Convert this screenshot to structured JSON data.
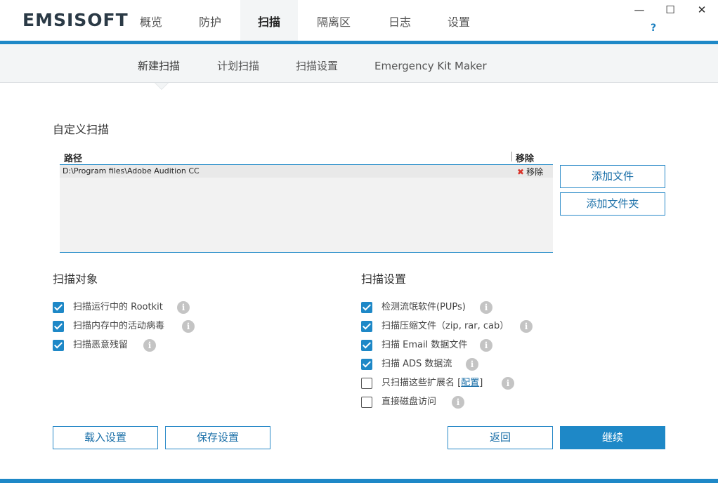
{
  "app": {
    "logo": "EMSISOFT"
  },
  "nav": {
    "tabs": [
      {
        "label": "概览"
      },
      {
        "label": "防护"
      },
      {
        "label": "扫描"
      },
      {
        "label": "隔离区"
      },
      {
        "label": "日志"
      },
      {
        "label": "设置"
      }
    ],
    "active": "扫描"
  },
  "window": {
    "minimize": "—",
    "maximize": "☐",
    "close": "✕",
    "help": "?"
  },
  "subnav": {
    "tabs": [
      {
        "label": "新建扫描"
      },
      {
        "label": "计划扫描"
      },
      {
        "label": "扫描设置"
      },
      {
        "label": "Emergency Kit Maker"
      }
    ],
    "active": "新建扫描"
  },
  "custom_scan": {
    "title": "自定义扫描",
    "columns": {
      "path": "路径",
      "remove": "移除"
    },
    "rows": [
      {
        "path": "D:\\Program files\\Adobe Audition CC",
        "remove": "移除"
      }
    ],
    "add_file": "添加文件",
    "add_folder": "添加文件夹"
  },
  "scan_targets": {
    "title": "扫描对象",
    "options": [
      {
        "label": "扫描运行中的 Rootkit",
        "checked": true
      },
      {
        "label": "扫描内存中的活动病毒",
        "checked": true
      },
      {
        "label": "扫描恶意残留",
        "checked": true
      }
    ]
  },
  "scan_settings": {
    "title": "扫描设置",
    "options": [
      {
        "label": "检测流氓软件(PUPs)",
        "checked": true
      },
      {
        "label": "扫描压缩文件（zip, rar, cab）",
        "checked": true
      },
      {
        "label": "扫描 Email 数据文件",
        "checked": true
      },
      {
        "label": "扫描 ADS 数据流",
        "checked": true
      },
      {
        "label": "只扫描这些扩展名 [",
        "link": "配置",
        "suffix": "]",
        "checked": false
      },
      {
        "label": "直接磁盘访问",
        "checked": false
      }
    ]
  },
  "footer": {
    "load": "载入设置",
    "save": "保存设置",
    "back": "返回",
    "continue": "继续"
  },
  "colors": {
    "accent": "#1e88c7",
    "remove_x": "#d9342b"
  }
}
